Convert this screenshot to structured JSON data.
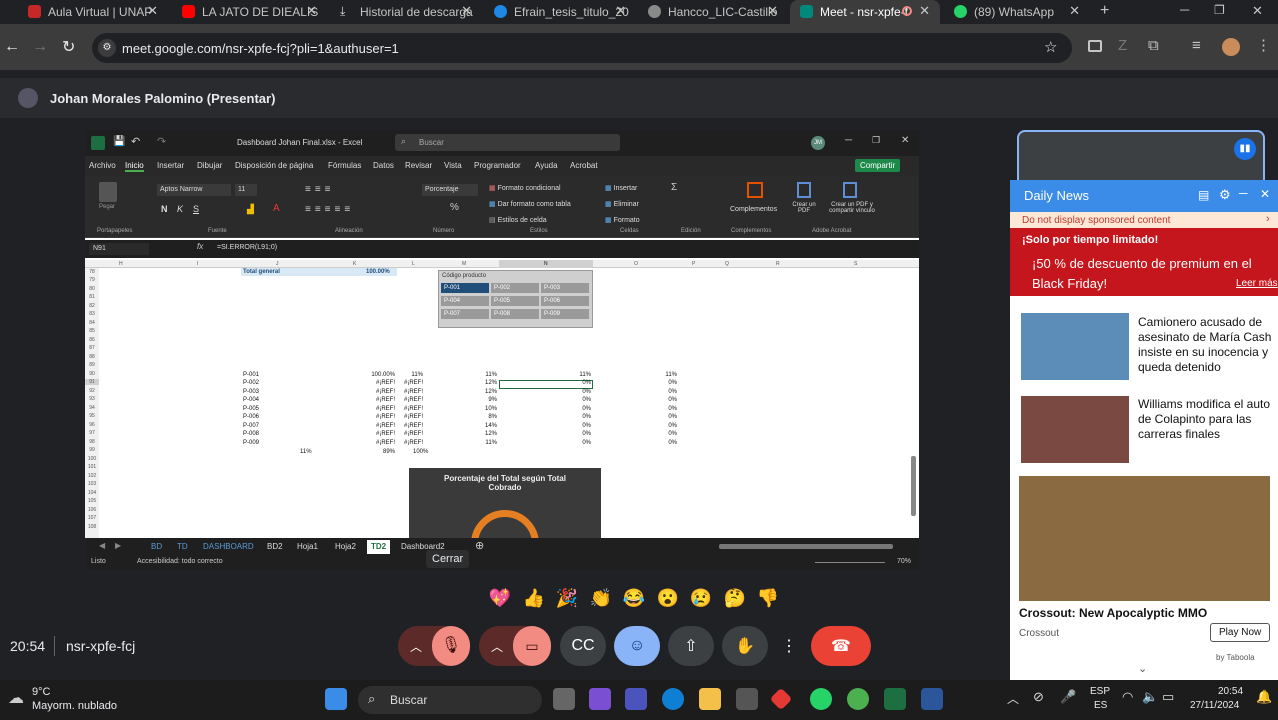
{
  "browser": {
    "tabs": [
      {
        "label": "Aula Virtual | UNAP",
        "color": "#c62828"
      },
      {
        "label": "LA JATO DE DIEALIS",
        "color": "#ff0000"
      },
      {
        "label": "Historial de descarga",
        "color": "#8a8a8a"
      },
      {
        "label": "Efrain_tesis_titulo_20",
        "color": "#1e88e5"
      },
      {
        "label": "Hancco_LIC-Castillo",
        "color": "#8a8a8a"
      },
      {
        "label": "Meet - nsr-xpfe-f",
        "color": "#00897b"
      },
      {
        "label": "(89) WhatsApp",
        "color": "#25d366"
      }
    ],
    "url": "meet.google.com/nsr-xpfe-fcj?pli=1&authuser=1"
  },
  "meet": {
    "presenter": "Johan Morales Palomino (Presentar)",
    "time": "20:54",
    "meeting_code": "nsr-xpfe-fcj",
    "tooltip": "Cerrar",
    "emojis": [
      "💖",
      "👍",
      "🎉",
      "👏",
      "😂",
      "😮",
      "😢",
      "🤔",
      "👎"
    ]
  },
  "excel": {
    "title": "Dashboard Johan Final.xlsx - Excel",
    "search": "Buscar",
    "user_initials": "JM",
    "menu": [
      "Archivo",
      "Inicio",
      "Insertar",
      "Dibujar",
      "Disposición de página",
      "Fórmulas",
      "Datos",
      "Revisar",
      "Vista",
      "Programador",
      "Ayuda",
      "Acrobat"
    ],
    "share": "Compartir",
    "ribbon": {
      "groups": [
        "Portapapeles",
        "Fuente",
        "Alineación",
        "Número",
        "Estilos",
        "Celdas",
        "Edición",
        "Complementos",
        "Adobe Acrobat"
      ],
      "paste": "Pegar",
      "font_name": "Aptos Narrow",
      "font_size": "11",
      "number_format": "Porcentaje",
      "cond_format": "Formato condicional",
      "table_format": "Dar formato como tabla",
      "cell_styles": "Estilos de celda",
      "insert": "Insertar",
      "delete": "Eliminar",
      "format": "Formato",
      "addins": "Complementos",
      "create_pdf": "Crear un PDF",
      "create_pdf_link": "Crear un PDF y compartir vínculo"
    },
    "name_box": "N91",
    "formula": "=SI.ERROR(L91;0)",
    "columns": [
      "H",
      "I",
      "J",
      "K",
      "L",
      "M",
      "N",
      "O",
      "P",
      "Q",
      "R",
      "S"
    ],
    "rows": [
      "78",
      "79",
      "80",
      "81",
      "82",
      "83",
      "84",
      "85",
      "86",
      "87",
      "88",
      "89",
      "90",
      "91",
      "92",
      "93",
      "94",
      "95",
      "96",
      "97",
      "98",
      "99",
      "100",
      "101",
      "102",
      "103",
      "104",
      "105",
      "106",
      "107",
      "108"
    ],
    "total_label": "Total general",
    "total_value": "100.00%",
    "slicer": {
      "title": "Código producto",
      "items": [
        "P-001",
        "P-002",
        "P-003",
        "P-004",
        "P-005",
        "P-006",
        "P-007",
        "P-008",
        "P-009"
      ]
    },
    "products": [
      "P-001",
      "P-002",
      "P-003",
      "P-004",
      "P-005",
      "P-006",
      "P-007",
      "P-008",
      "P-009"
    ],
    "col_k": [
      "100.00%",
      "#¡REF!",
      "#¡REF!",
      "#¡REF!",
      "#¡REF!",
      "#¡REF!",
      "#¡REF!",
      "#¡REF!",
      "#¡REF!"
    ],
    "col_l": [
      "11%",
      "#¡REF!",
      "#¡REF!",
      "#¡REF!",
      "#¡REF!",
      "#¡REF!",
      "#¡REF!",
      "#¡REF!",
      "#¡REF!"
    ],
    "col_m": [
      "11%",
      "12%",
      "12%",
      "9%",
      "10%",
      "8%",
      "14%",
      "12%",
      "11%"
    ],
    "col_n": [
      "11%",
      "0%",
      "0%",
      "0%",
      "0%",
      "0%",
      "0%",
      "0%",
      "0%"
    ],
    "col_p": [
      "11%",
      "0%",
      "0%",
      "0%",
      "0%",
      "0%",
      "0%",
      "0%",
      "0%"
    ],
    "totals_row": {
      "j": "11%",
      "k": "89%",
      "l": "100%"
    },
    "chart_title": "Porcentaje del Total según Total Cobrado",
    "sheets": [
      "BD",
      "TD",
      "DASHBOARD",
      "BD2",
      "Hoja1",
      "Hoja2",
      "TD2",
      "Dashboard2"
    ],
    "status_ready": "Listo",
    "accessibility": "Accesibilidad: todo correcto",
    "zoom": "70%"
  },
  "news": {
    "title": "Daily News",
    "sponsored": "Do not display sponsored content",
    "promo_top": "¡Solo por tiempo limitado!",
    "promo_main": "¡50 % de descuento de premium en el Black Friday!",
    "promo_more": "Leer más",
    "item1": "Camionero acusado de asesinato de María Cash insiste en su inocencia y queda detenido",
    "item2": "Williams modifica el auto de Colapinto para las carreras finales",
    "ad_title": "Crossout: New Apocalyptic MMO",
    "ad_source": "Crossout",
    "ad_button": "Play Now",
    "taboola": "by Taboola"
  },
  "taskbar": {
    "weather_temp": "9°C",
    "weather_desc": "Mayorm. nublado",
    "search": "Buscar",
    "lang1": "ESP",
    "lang2": "ES",
    "clock_time": "20:54",
    "clock_date": "27/11/2024"
  }
}
